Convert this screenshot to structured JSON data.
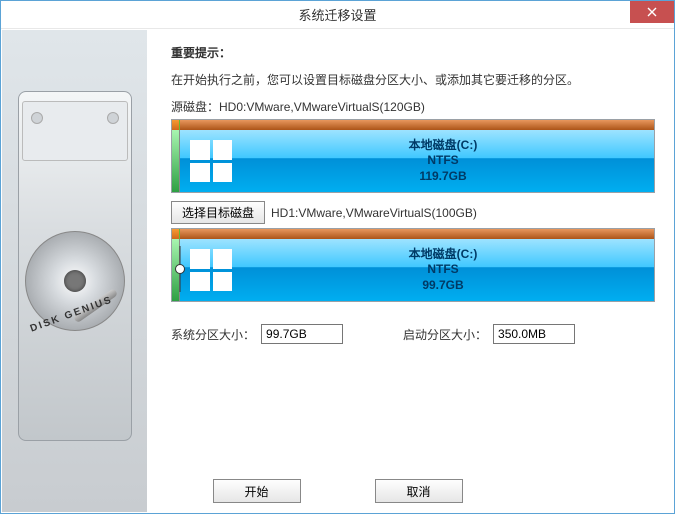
{
  "window": {
    "title": "系统迁移设置"
  },
  "heading": "重要提示：",
  "description": "在开始执行之前，您可以设置目标磁盘分区大小、或添加其它要迁移的分区。",
  "source_disk": {
    "label": "源磁盘：",
    "text": "HD0:VMware,VMwareVirtualS(120GB)"
  },
  "source_partition": {
    "name": "本地磁盘(C:)",
    "fs": "NTFS",
    "size": "119.7GB"
  },
  "select_target": {
    "button": "选择目标磁盘",
    "text": "HD1:VMware,VMwareVirtualS(100GB)"
  },
  "target_partition": {
    "name": "本地磁盘(C:)",
    "fs": "NTFS",
    "size": "99.7GB"
  },
  "fields": {
    "system_size": {
      "label": "系统分区大小：",
      "value": "99.7GB"
    },
    "boot_size": {
      "label": "启动分区大小：",
      "value": "350.0MB"
    }
  },
  "buttons": {
    "start": "开始",
    "cancel": "取消"
  },
  "sidebar": {
    "brand": "DISK GENIUS"
  }
}
